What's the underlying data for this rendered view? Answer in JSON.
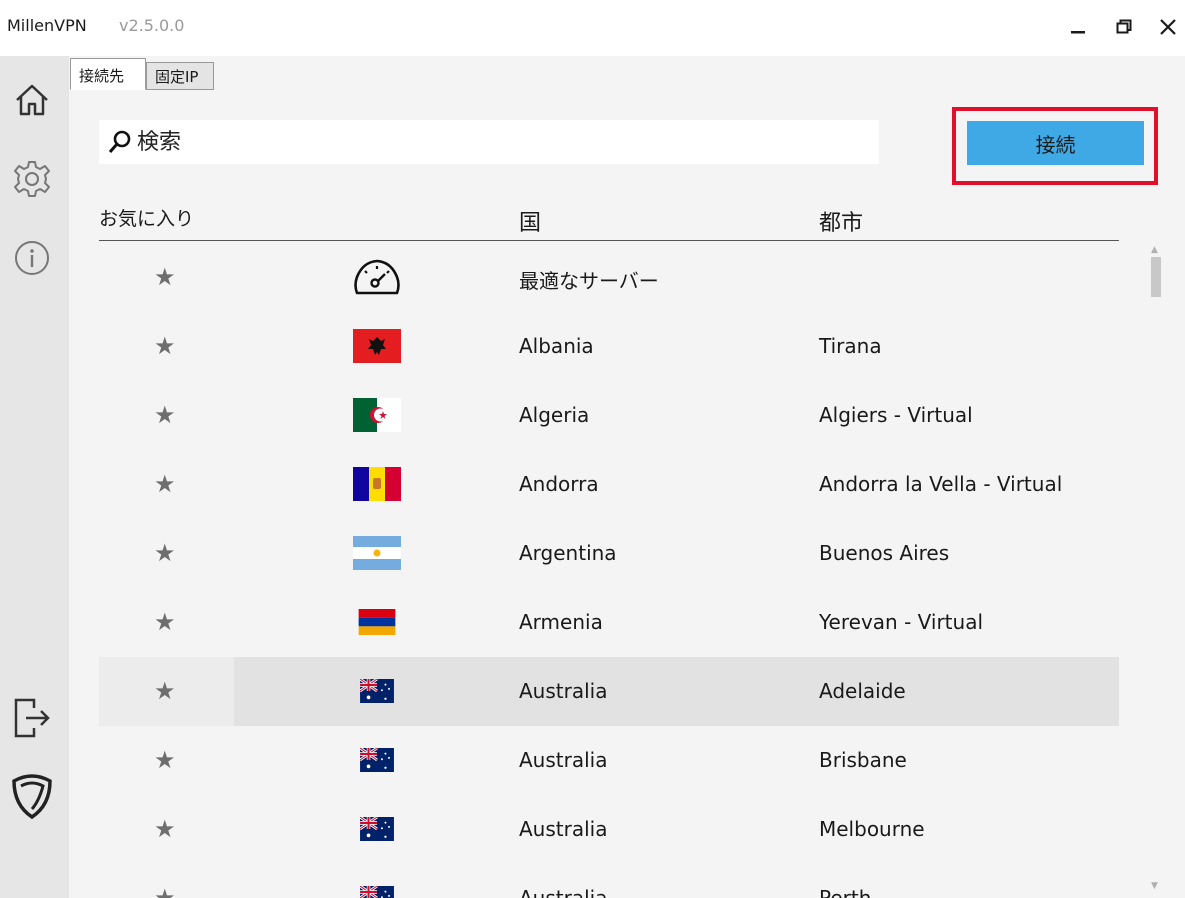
{
  "app": {
    "name": "MillenVPN",
    "version": "v2.5.0.0"
  },
  "tabs": [
    {
      "label": "接続先",
      "active": true
    },
    {
      "label": "固定IP",
      "active": false
    }
  ],
  "search": {
    "placeholder": "検索",
    "value": ""
  },
  "connect_button": {
    "label": "接続",
    "color": "#3fa9e6",
    "highlight_color": "#e0102a"
  },
  "columns": {
    "favorite": "お気に入り",
    "country": "国",
    "city": "都市"
  },
  "sidebar": {
    "icons": [
      "home-icon",
      "gear-icon",
      "info-icon",
      "logout-icon",
      "shield-icon"
    ]
  },
  "servers": [
    {
      "country": "最適なサーバー",
      "city": "",
      "flag": "speedometer-icon",
      "selected": false
    },
    {
      "country": "Albania",
      "city": "Tirana",
      "flag": "albania",
      "selected": false
    },
    {
      "country": "Algeria",
      "city": "Algiers - Virtual",
      "flag": "algeria",
      "selected": false
    },
    {
      "country": "Andorra",
      "city": "Andorra la Vella - Virtual",
      "flag": "andorra",
      "selected": false
    },
    {
      "country": "Argentina",
      "city": "Buenos Aires",
      "flag": "argentina",
      "selected": false
    },
    {
      "country": "Armenia",
      "city": "Yerevan - Virtual",
      "flag": "armenia",
      "selected": false
    },
    {
      "country": "Australia",
      "city": "Adelaide",
      "flag": "australia",
      "selected": true
    },
    {
      "country": "Australia",
      "city": "Brisbane",
      "flag": "australia",
      "selected": false
    },
    {
      "country": "Australia",
      "city": "Melbourne",
      "flag": "australia",
      "selected": false
    },
    {
      "country": "Australia",
      "city": "Perth",
      "flag": "australia",
      "selected": false
    }
  ]
}
